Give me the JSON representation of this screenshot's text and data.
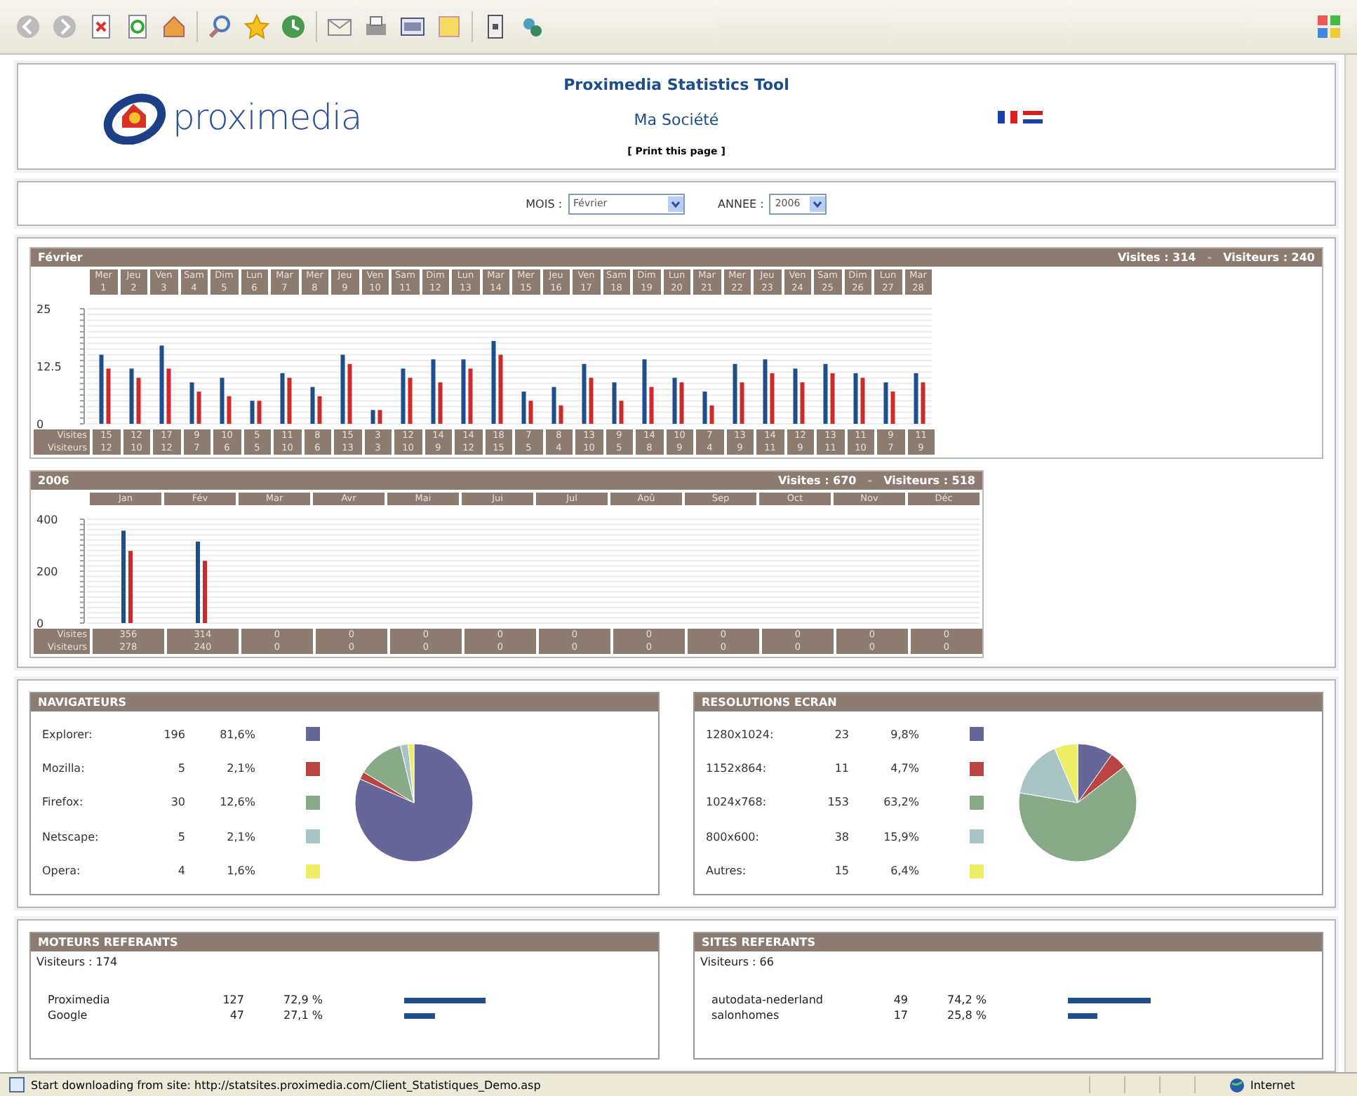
{
  "header": {
    "logo_text": "proximedia",
    "title": "Proximedia Statistics Tool",
    "company": "Ma Société",
    "print_link": "[ Print this page ]"
  },
  "filters": [
    {
      "label": "MOIS :",
      "value": "Février"
    },
    {
      "label": "ANNEE :",
      "value": "2006"
    }
  ],
  "daily": {
    "title": "Février",
    "visits_total": "Visites : 314",
    "separator": "-",
    "visitors_total": "Visiteurs : 240",
    "table": [
      {
        "label": "Visites",
        "cells": [
          "15",
          "12",
          "17",
          "9",
          "10",
          "5",
          "11",
          "8",
          "15",
          "3",
          "12",
          "14",
          "14",
          "18",
          "7",
          "8",
          "13",
          "9",
          "14",
          "10",
          "7",
          "13",
          "14",
          "12",
          "13",
          "11",
          "9",
          "11"
        ]
      },
      {
        "label": "Visiteurs",
        "cells": [
          "12",
          "10",
          "12",
          "7",
          "6",
          "5",
          "10",
          "6",
          "13",
          "3",
          "10",
          "9",
          "12",
          "15",
          "5",
          "4",
          "10",
          "5",
          "8",
          "9",
          "4",
          "9",
          "11",
          "9",
          "11",
          "10",
          "7",
          "9"
        ]
      }
    ],
    "chart_data": {
      "type": "bar",
      "categories": [
        "Mer 1",
        "Jeu 2",
        "Ven 3",
        "Sam 4",
        "Dim 5",
        "Lun 6",
        "Mar 7",
        "Mer 8",
        "Jeu 9",
        "Ven 10",
        "Sam 11",
        "Dim 12",
        "Lun 13",
        "Mar 14",
        "Mer 15",
        "Jeu 16",
        "Ven 17",
        "Sam 18",
        "Dim 19",
        "Lun 20",
        "Mar 21",
        "Mer 22",
        "Jeu 23",
        "Ven 24",
        "Sam 25",
        "Dim 26",
        "Lun 27",
        "Mar 28"
      ],
      "ylim": [
        0,
        25
      ],
      "yticks": [
        0,
        12.5,
        25
      ],
      "series": [
        {
          "color": "#1f4e8c",
          "values": [
            15,
            12,
            17,
            9,
            10,
            5,
            11,
            8,
            15,
            3,
            12,
            14,
            14,
            18,
            7,
            8,
            13,
            9,
            14,
            10,
            7,
            13,
            14,
            12,
            13,
            11,
            9,
            11
          ]
        },
        {
          "color": "#cc2b2b",
          "values": [
            12,
            10,
            12,
            7,
            6,
            5,
            10,
            6,
            13,
            3,
            10,
            9,
            12,
            15,
            5,
            4,
            10,
            5,
            8,
            9,
            4,
            9,
            11,
            9,
            11,
            10,
            7,
            9
          ]
        }
      ]
    }
  },
  "monthly": {
    "title": "2006",
    "visits_total": "Visites : 670",
    "separator": "-",
    "visitors_total": "Visiteurs : 518",
    "table": [
      {
        "label": "Visites",
        "cells": [
          "356",
          "314",
          "0",
          "0",
          "0",
          "0",
          "0",
          "0",
          "0",
          "0",
          "0",
          "0"
        ]
      },
      {
        "label": "Visiteurs",
        "cells": [
          "278",
          "240",
          "0",
          "0",
          "0",
          "0",
          "0",
          "0",
          "0",
          "0",
          "0",
          "0"
        ]
      }
    ],
    "chart_data": {
      "type": "bar",
      "categories": [
        "Jan",
        "Fév",
        "Mar",
        "Avr",
        "Mai",
        "Jui",
        "Jul",
        "Aoû",
        "Sep",
        "Oct",
        "Nov",
        "Déc"
      ],
      "ylim": [
        0,
        400
      ],
      "yticks": [
        0,
        200,
        400
      ],
      "series": [
        {
          "color": "#1f4e8c",
          "values": [
            356,
            314,
            0,
            0,
            0,
            0,
            0,
            0,
            0,
            0,
            0,
            0
          ]
        },
        {
          "color": "#cc2b2b",
          "values": [
            278,
            240,
            0,
            0,
            0,
            0,
            0,
            0,
            0,
            0,
            0,
            0
          ]
        }
      ]
    }
  },
  "breakdowns": [
    {
      "title": "NAVIGATEURS",
      "rows": [
        {
          "label": "Explorer:",
          "count": "196",
          "percent": "81,6%",
          "color": "#666699"
        },
        {
          "label": "Mozilla:",
          "count": "5",
          "percent": "2,1%",
          "color": "#b84444"
        },
        {
          "label": "Firefox:",
          "count": "30",
          "percent": "12,6%",
          "color": "#88aa88"
        },
        {
          "label": "Netscape:",
          "count": "5",
          "percent": "2,1%",
          "color": "#a8c4c4"
        },
        {
          "label": "Opera:",
          "count": "4",
          "percent": "1,6%",
          "color": "#eeee66"
        }
      ],
      "chart_data": {
        "type": "pie",
        "values": [
          81.6,
          2.1,
          12.6,
          2.1,
          1.6
        ]
      }
    },
    {
      "title": "RESOLUTIONS ECRAN",
      "rows": [
        {
          "label": "1280x1024:",
          "count": "23",
          "percent": "9,8%",
          "color": "#666699"
        },
        {
          "label": "1152x864:",
          "count": "11",
          "percent": "4,7%",
          "color": "#b84444"
        },
        {
          "label": "1024x768:",
          "count": "153",
          "percent": "63,2%",
          "color": "#88aa88"
        },
        {
          "label": "800x600:",
          "count": "38",
          "percent": "15,9%",
          "color": "#a8c4c4"
        },
        {
          "label": "Autres:",
          "count": "15",
          "percent": "6,4%",
          "color": "#eeee66"
        }
      ],
      "chart_data": {
        "type": "pie",
        "values": [
          9.8,
          4.7,
          63.2,
          15.9,
          6.4
        ]
      }
    }
  ],
  "referrers": [
    {
      "title": "MOTEURS REFERANTS",
      "visitors": "Visiteurs : 174",
      "rows": [
        {
          "name": "Proximedia",
          "count": "127",
          "percent": "72,9 %"
        },
        {
          "name": "Google",
          "count": "47",
          "percent": "27,1 %"
        }
      ]
    },
    {
      "title": "SITES REFERANTS",
      "visitors": "Visiteurs : 66",
      "rows": [
        {
          "name": "autodata-nederland",
          "count": "49",
          "percent": "74,2 %"
        },
        {
          "name": "salonhomes",
          "count": "17",
          "percent": "25,8 %"
        }
      ]
    }
  ],
  "status_bar": {
    "text": "Start downloading from site: http://statsites.proximedia.com/Client_Statistiques_Demo.asp",
    "zone": "Internet"
  }
}
